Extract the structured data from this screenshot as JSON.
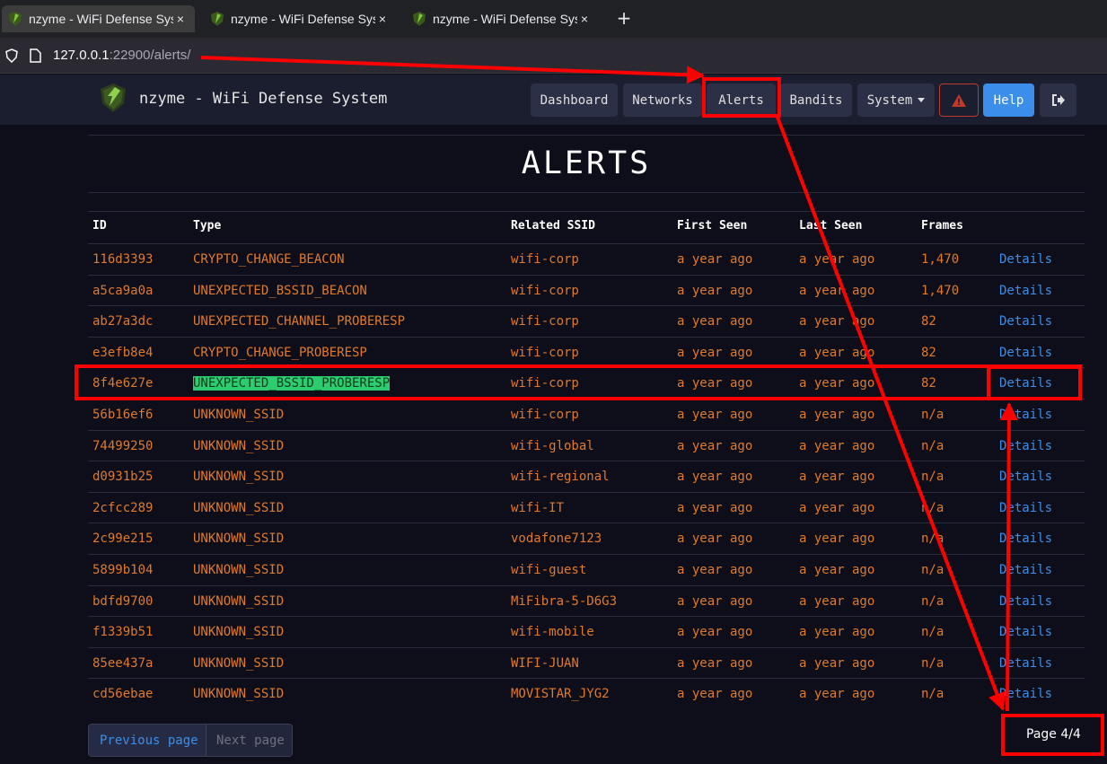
{
  "browser": {
    "tabs": [
      {
        "title": "nzyme - WiFi Defense System",
        "close": "×"
      },
      {
        "title": "nzyme - WiFi Defense System",
        "close": "×"
      },
      {
        "title": "nzyme - WiFi Defense System",
        "close": "×"
      }
    ],
    "new_tab": "+",
    "url_host": "127.0.0.1",
    "url_rest": ":22900/alerts/"
  },
  "navbar": {
    "brand": "nzyme - WiFi Defense System",
    "items": {
      "dashboard": "Dashboard",
      "networks": "Networks",
      "alerts": "Alerts",
      "bandits": "Bandits",
      "system": "System",
      "help": "Help"
    }
  },
  "page": {
    "title": "ALERTS",
    "columns": {
      "id": "ID",
      "type": "Type",
      "ssid": "Related SSID",
      "first_seen": "First Seen",
      "last_seen": "Last Seen",
      "frames": "Frames"
    },
    "rows": [
      {
        "id": "116d3393",
        "type": "CRYPTO_CHANGE_BEACON",
        "ssid": "wifi-corp",
        "first": "a year ago",
        "last": "a year ago",
        "frames": "1,470",
        "action": "Details"
      },
      {
        "id": "a5ca9a0a",
        "type": "UNEXPECTED_BSSID_BEACON",
        "ssid": "wifi-corp",
        "first": "a year ago",
        "last": "a year ago",
        "frames": "1,470",
        "action": "Details"
      },
      {
        "id": "ab27a3dc",
        "type": "UNEXPECTED_CHANNEL_PROBERESP",
        "ssid": "wifi-corp",
        "first": "a year ago",
        "last": "a year ago",
        "frames": "82",
        "action": "Details"
      },
      {
        "id": "e3efb8e4",
        "type": "CRYPTO_CHANGE_PROBERESP",
        "ssid": "wifi-corp",
        "first": "a year ago",
        "last": "a year ago",
        "frames": "82",
        "action": "Details"
      },
      {
        "id": "8f4e627e",
        "type": "UNEXPECTED_BSSID_PROBERESP",
        "ssid": "wifi-corp",
        "first": "a year ago",
        "last": "a year ago",
        "frames": "82",
        "action": "Details"
      },
      {
        "id": "56b16ef6",
        "type": "UNKNOWN_SSID",
        "ssid": "wifi-corp",
        "first": "a year ago",
        "last": "a year ago",
        "frames": "n/a",
        "action": "Details"
      },
      {
        "id": "74499250",
        "type": "UNKNOWN_SSID",
        "ssid": "wifi-global",
        "first": "a year ago",
        "last": "a year ago",
        "frames": "n/a",
        "action": "Details"
      },
      {
        "id": "d0931b25",
        "type": "UNKNOWN_SSID",
        "ssid": "wifi-regional",
        "first": "a year ago",
        "last": "a year ago",
        "frames": "n/a",
        "action": "Details"
      },
      {
        "id": "2cfcc289",
        "type": "UNKNOWN_SSID",
        "ssid": "wifi-IT",
        "first": "a year ago",
        "last": "a year ago",
        "frames": "n/a",
        "action": "Details"
      },
      {
        "id": "2c99e215",
        "type": "UNKNOWN_SSID",
        "ssid": "vodafone7123",
        "first": "a year ago",
        "last": "a year ago",
        "frames": "n/a",
        "action": "Details"
      },
      {
        "id": "5899b104",
        "type": "UNKNOWN_SSID",
        "ssid": "wifi-guest",
        "first": "a year ago",
        "last": "a year ago",
        "frames": "n/a",
        "action": "Details"
      },
      {
        "id": "bdfd9700",
        "type": "UNKNOWN_SSID",
        "ssid": "MiFibra-5-D6G3",
        "first": "a year ago",
        "last": "a year ago",
        "frames": "n/a",
        "action": "Details"
      },
      {
        "id": "f1339b51",
        "type": "UNKNOWN_SSID",
        "ssid": "wifi-mobile",
        "first": "a year ago",
        "last": "a year ago",
        "frames": "n/a",
        "action": "Details"
      },
      {
        "id": "85ee437a",
        "type": "UNKNOWN_SSID",
        "ssid": "WIFI-JUAN",
        "first": "a year ago",
        "last": "a year ago",
        "frames": "n/a",
        "action": "Details"
      },
      {
        "id": "cd56ebae",
        "type": "UNKNOWN_SSID",
        "ssid": "MOVISTAR_JYG2",
        "first": "a year ago",
        "last": "a year ago",
        "frames": "n/a",
        "action": "Details"
      }
    ],
    "pagination": {
      "previous": "Previous page",
      "next": "Next page",
      "info": "Page 4/4"
    }
  },
  "colors": {
    "accent_orange": "#e07a2a",
    "link_blue": "#3b8eea",
    "highlight_green": "#2ecc71",
    "annotation_red": "#ff0000"
  },
  "icons": [
    "nzyme-logo-icon",
    "shield-icon",
    "page-icon",
    "warning-icon",
    "logout-icon",
    "chevron-down-icon"
  ]
}
